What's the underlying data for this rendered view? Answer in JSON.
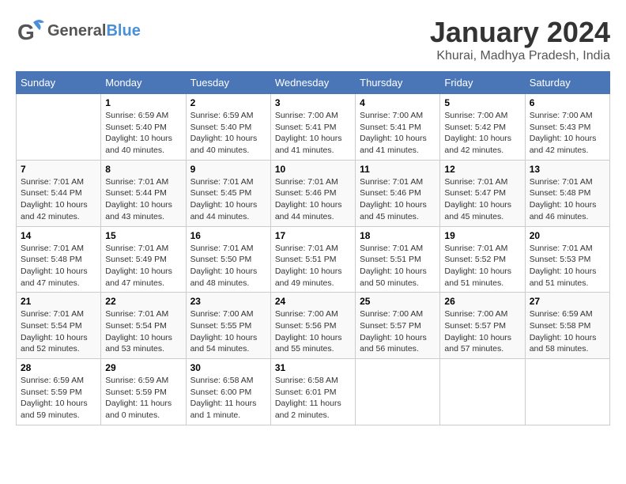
{
  "header": {
    "logo_general": "General",
    "logo_blue": "Blue",
    "month_title": "January 2024",
    "location": "Khurai, Madhya Pradesh, India"
  },
  "days_of_week": [
    "Sunday",
    "Monday",
    "Tuesday",
    "Wednesday",
    "Thursday",
    "Friday",
    "Saturday"
  ],
  "weeks": [
    [
      {
        "day": "",
        "info": ""
      },
      {
        "day": "1",
        "info": "Sunrise: 6:59 AM\nSunset: 5:40 PM\nDaylight: 10 hours\nand 40 minutes."
      },
      {
        "day": "2",
        "info": "Sunrise: 6:59 AM\nSunset: 5:40 PM\nDaylight: 10 hours\nand 40 minutes."
      },
      {
        "day": "3",
        "info": "Sunrise: 7:00 AM\nSunset: 5:41 PM\nDaylight: 10 hours\nand 41 minutes."
      },
      {
        "day": "4",
        "info": "Sunrise: 7:00 AM\nSunset: 5:41 PM\nDaylight: 10 hours\nand 41 minutes."
      },
      {
        "day": "5",
        "info": "Sunrise: 7:00 AM\nSunset: 5:42 PM\nDaylight: 10 hours\nand 42 minutes."
      },
      {
        "day": "6",
        "info": "Sunrise: 7:00 AM\nSunset: 5:43 PM\nDaylight: 10 hours\nand 42 minutes."
      }
    ],
    [
      {
        "day": "7",
        "info": "Sunrise: 7:01 AM\nSunset: 5:44 PM\nDaylight: 10 hours\nand 42 minutes."
      },
      {
        "day": "8",
        "info": "Sunrise: 7:01 AM\nSunset: 5:44 PM\nDaylight: 10 hours\nand 43 minutes."
      },
      {
        "day": "9",
        "info": "Sunrise: 7:01 AM\nSunset: 5:45 PM\nDaylight: 10 hours\nand 44 minutes."
      },
      {
        "day": "10",
        "info": "Sunrise: 7:01 AM\nSunset: 5:46 PM\nDaylight: 10 hours\nand 44 minutes."
      },
      {
        "day": "11",
        "info": "Sunrise: 7:01 AM\nSunset: 5:46 PM\nDaylight: 10 hours\nand 45 minutes."
      },
      {
        "day": "12",
        "info": "Sunrise: 7:01 AM\nSunset: 5:47 PM\nDaylight: 10 hours\nand 45 minutes."
      },
      {
        "day": "13",
        "info": "Sunrise: 7:01 AM\nSunset: 5:48 PM\nDaylight: 10 hours\nand 46 minutes."
      }
    ],
    [
      {
        "day": "14",
        "info": "Sunrise: 7:01 AM\nSunset: 5:48 PM\nDaylight: 10 hours\nand 47 minutes."
      },
      {
        "day": "15",
        "info": "Sunrise: 7:01 AM\nSunset: 5:49 PM\nDaylight: 10 hours\nand 47 minutes."
      },
      {
        "day": "16",
        "info": "Sunrise: 7:01 AM\nSunset: 5:50 PM\nDaylight: 10 hours\nand 48 minutes."
      },
      {
        "day": "17",
        "info": "Sunrise: 7:01 AM\nSunset: 5:51 PM\nDaylight: 10 hours\nand 49 minutes."
      },
      {
        "day": "18",
        "info": "Sunrise: 7:01 AM\nSunset: 5:51 PM\nDaylight: 10 hours\nand 50 minutes."
      },
      {
        "day": "19",
        "info": "Sunrise: 7:01 AM\nSunset: 5:52 PM\nDaylight: 10 hours\nand 51 minutes."
      },
      {
        "day": "20",
        "info": "Sunrise: 7:01 AM\nSunset: 5:53 PM\nDaylight: 10 hours\nand 51 minutes."
      }
    ],
    [
      {
        "day": "21",
        "info": "Sunrise: 7:01 AM\nSunset: 5:54 PM\nDaylight: 10 hours\nand 52 minutes."
      },
      {
        "day": "22",
        "info": "Sunrise: 7:01 AM\nSunset: 5:54 PM\nDaylight: 10 hours\nand 53 minutes."
      },
      {
        "day": "23",
        "info": "Sunrise: 7:00 AM\nSunset: 5:55 PM\nDaylight: 10 hours\nand 54 minutes."
      },
      {
        "day": "24",
        "info": "Sunrise: 7:00 AM\nSunset: 5:56 PM\nDaylight: 10 hours\nand 55 minutes."
      },
      {
        "day": "25",
        "info": "Sunrise: 7:00 AM\nSunset: 5:57 PM\nDaylight: 10 hours\nand 56 minutes."
      },
      {
        "day": "26",
        "info": "Sunrise: 7:00 AM\nSunset: 5:57 PM\nDaylight: 10 hours\nand 57 minutes."
      },
      {
        "day": "27",
        "info": "Sunrise: 6:59 AM\nSunset: 5:58 PM\nDaylight: 10 hours\nand 58 minutes."
      }
    ],
    [
      {
        "day": "28",
        "info": "Sunrise: 6:59 AM\nSunset: 5:59 PM\nDaylight: 10 hours\nand 59 minutes."
      },
      {
        "day": "29",
        "info": "Sunrise: 6:59 AM\nSunset: 5:59 PM\nDaylight: 11 hours\nand 0 minutes."
      },
      {
        "day": "30",
        "info": "Sunrise: 6:58 AM\nSunset: 6:00 PM\nDaylight: 11 hours\nand 1 minute."
      },
      {
        "day": "31",
        "info": "Sunrise: 6:58 AM\nSunset: 6:01 PM\nDaylight: 11 hours\nand 2 minutes."
      },
      {
        "day": "",
        "info": ""
      },
      {
        "day": "",
        "info": ""
      },
      {
        "day": "",
        "info": ""
      }
    ]
  ]
}
